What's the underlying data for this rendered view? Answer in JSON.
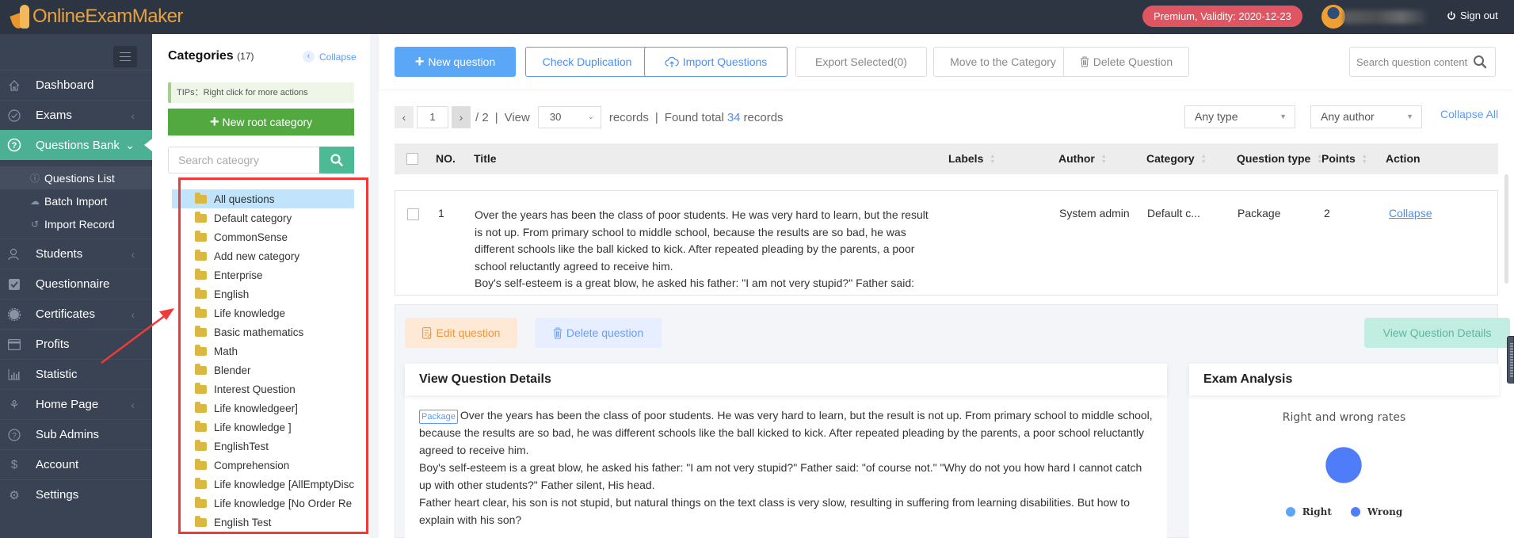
{
  "header": {
    "brand": "OnlineExamMaker",
    "premium_badge": "Premium, Validity: 2020-12-23",
    "signout_label": "Sign out"
  },
  "sidebar": {
    "items": [
      {
        "label": "Dashboard",
        "icon": "home-icon",
        "chevron": false
      },
      {
        "label": "Exams",
        "icon": "check-circle-icon",
        "chevron": true
      },
      {
        "label": "Questions Bank",
        "icon": "question-circle-icon",
        "chevron": true,
        "active": true
      },
      {
        "label": "Students",
        "icon": "users-icon",
        "chevron": true
      },
      {
        "label": "Questionnaire",
        "icon": "checkbox-icon",
        "chevron": false
      },
      {
        "label": "Certificates",
        "icon": "badge-icon",
        "chevron": true
      },
      {
        "label": "Profits",
        "icon": "credit-card-icon",
        "chevron": false
      },
      {
        "label": "Statistic",
        "icon": "bar-chart-icon",
        "chevron": false
      },
      {
        "label": "Home Page",
        "icon": "plant-icon",
        "chevron": true
      },
      {
        "label": "Sub Admins",
        "icon": "question-circle-icon",
        "chevron": false
      },
      {
        "label": "Account",
        "icon": "dollar-icon",
        "chevron": false
      },
      {
        "label": "Settings",
        "icon": "gear-icon",
        "chevron": false
      }
    ],
    "submenu": [
      {
        "label": "Questions List",
        "icon": "question-circle-icon",
        "current": true
      },
      {
        "label": "Batch Import",
        "icon": "cloud-upload-icon"
      },
      {
        "label": "Import Record",
        "icon": "history-icon"
      }
    ]
  },
  "categories": {
    "title": "Categories",
    "count": "(17)",
    "collapse_label": "Collapse",
    "tips": "TIPs：Right click for more actions",
    "new_root_label": "New root category",
    "search_placeholder": "Search cateogry",
    "items": [
      "All questions",
      "Default category",
      "CommonSense",
      "Add new category",
      "Enterprise",
      "English",
      "Life knowledge",
      "Basic mathematics",
      "Math",
      "Blender",
      "Interest Question",
      "Life knowledgeer]",
      "Life knowledge ]",
      "EnglishTest",
      "Comprehension",
      "Life knowledge [AllEmptyDisc",
      "Life knowledge [No Order Re",
      "English Test"
    ],
    "selected_index": 0
  },
  "toolbar": {
    "new_question": "New question",
    "check_duplication": "Check Duplication",
    "import_questions": "Import Questions",
    "export_selected": "Export Selected(0)",
    "move_to_category": "Move to the Category",
    "delete_question": "Delete Question",
    "search_placeholder": "Search question content"
  },
  "pager": {
    "current_page": "1",
    "total_pages": "/ 2",
    "view_label": "View",
    "per_page": "30",
    "records_label": "records",
    "found_label": "Found total",
    "total_records": "34",
    "records_suffix": "records"
  },
  "filters": {
    "type": "Any type",
    "author": "Any author",
    "collapse_all": "Collapse All"
  },
  "table": {
    "columns": [
      "NO.",
      "Title",
      "Labels",
      "Author",
      "Category",
      "Question type",
      "Points",
      "Action"
    ],
    "rows": [
      {
        "no": "1",
        "title": "Over the years has been the class of poor students. He was very hard to learn, but the result is not up. From primary school to middle school, because the results are so bad, he was different schools like the ball kicked to kick. After repeated pleading by the parents, a poor school reluctantly agreed to receive him.\nBoy's self-esteem is a great blow, he asked his father: \"I am not very stupid?\" Father said: \"of",
        "labels": "",
        "author": "System admin",
        "category": "Default c...",
        "type": "Package",
        "points": "2",
        "action": "Collapse"
      }
    ]
  },
  "detail": {
    "edit_label": "Edit question",
    "delete_label": "Delete question",
    "view_details_label": "View Question Details",
    "question_card_title": "View Question Details",
    "tag": "Package",
    "paragraphs": [
      "Over the years has been the class of poor students. He was very hard to learn, but the result is not up. From primary school to middle school, because the results are so bad, he was different schools like the ball kicked to kick. After repeated pleading by the parents, a poor school reluctantly agreed to receive him.",
      "Boy's self-esteem is a great blow, he asked his father: \"I am not very stupid?\" Father said: \"of course not.\" \"Why do not you how hard I cannot catch up with other students?\" Father silent, His head.",
      "Father heart clear, his son is not stupid, but natural things on the text class is very slow, resulting in suffering from learning disabilities. But how to explain with his son?"
    ],
    "analysis_title": "Exam Analysis"
  },
  "chart_data": {
    "type": "pie",
    "title": "Right and wrong rates",
    "categories": [
      "Right",
      "Wrong"
    ],
    "values": [
      0,
      100
    ],
    "colors": [
      "#5aa7f8",
      "#4f7cf8"
    ],
    "legend": "bottom"
  }
}
